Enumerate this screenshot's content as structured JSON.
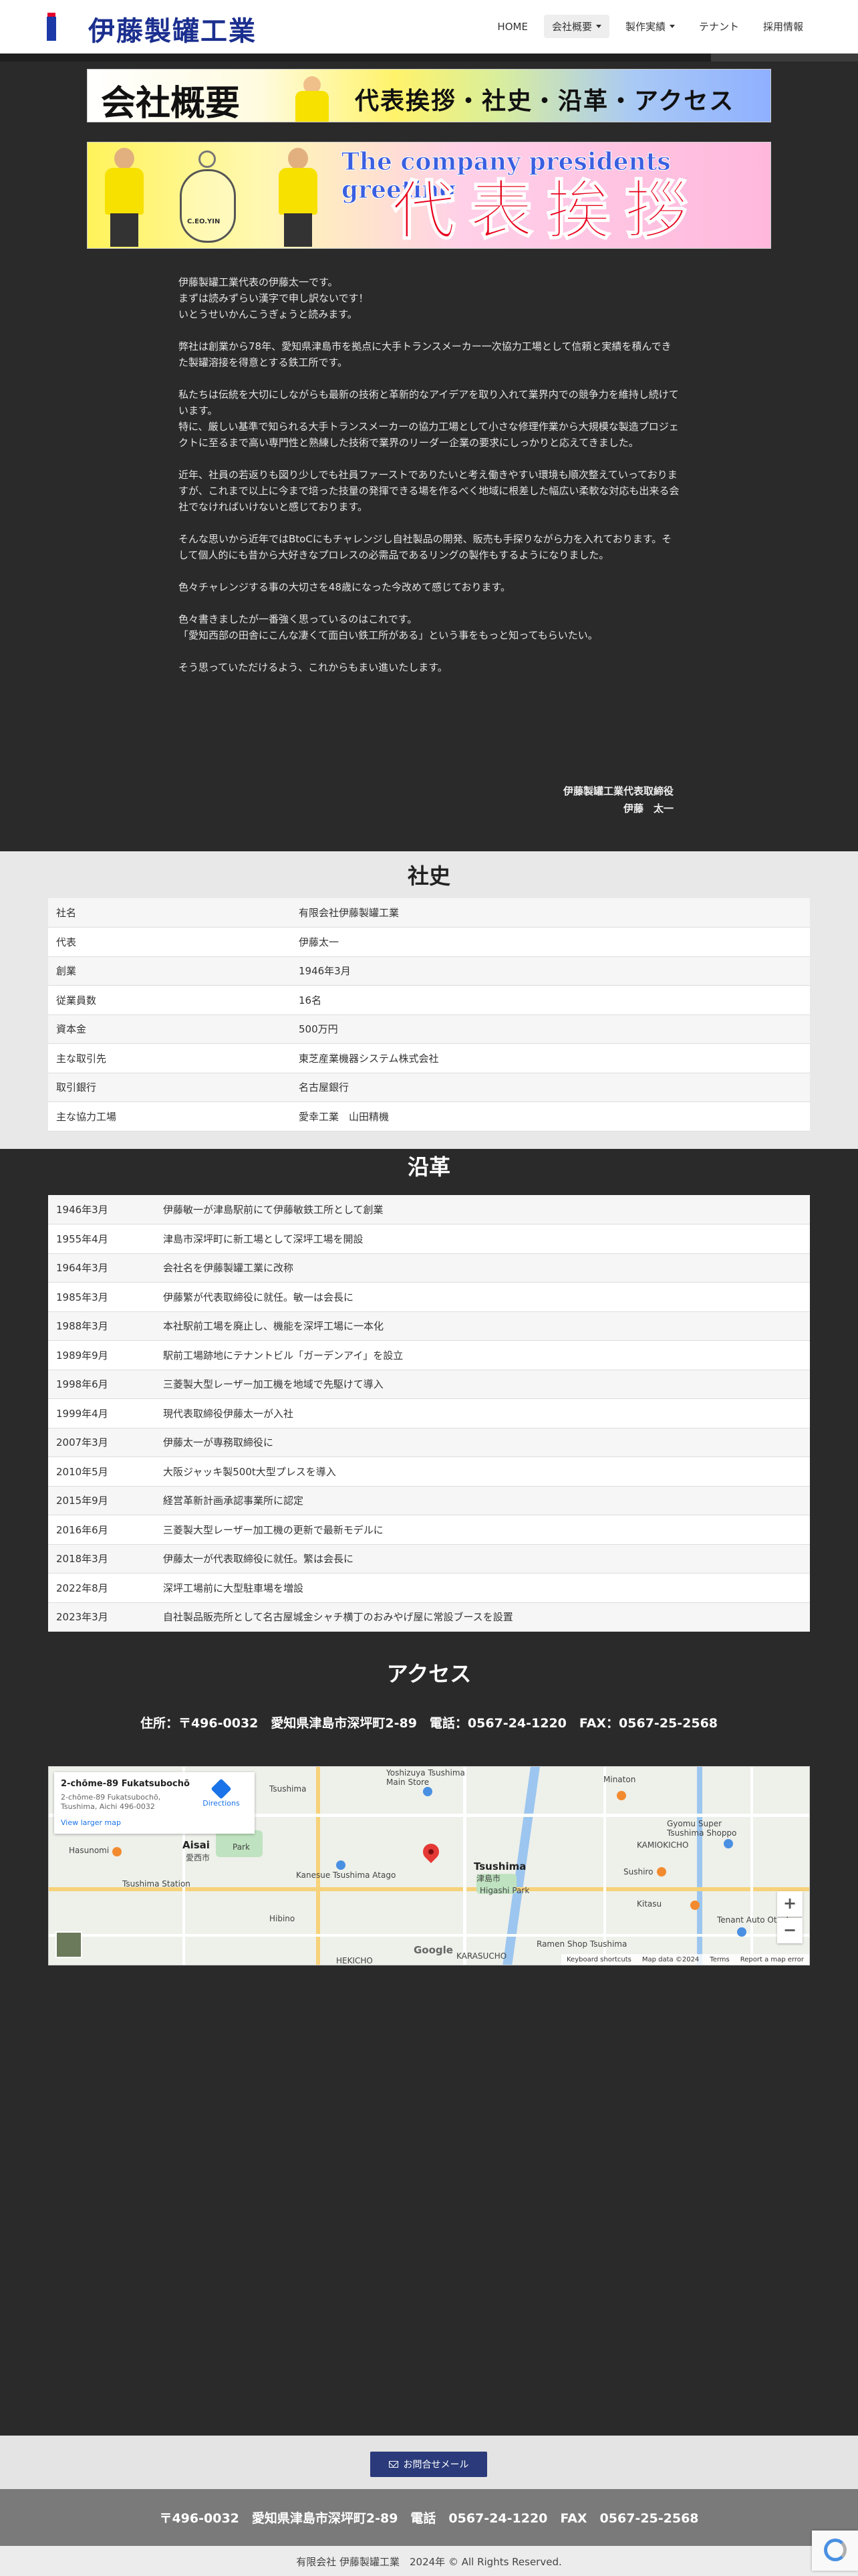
{
  "header": {
    "logo_text": "伊藤製罐工業",
    "logo_mark": "iS",
    "nav": [
      {
        "label": "HOME"
      },
      {
        "label": "会社概要"
      },
      {
        "label": "製作実績"
      },
      {
        "label": "テナント"
      },
      {
        "label": "採用情報"
      }
    ]
  },
  "banners": {
    "about_title": "会社概要",
    "about_subtitle": "代表挨拶・社史・沿革・アクセス",
    "greeting_en": "The company presidents greeting",
    "greeting_jp": "代表挨拶",
    "keychain_text": "C.EO.YIN"
  },
  "greeting": {
    "p1_l1": "伊藤製罐工業代表の伊藤太一です。",
    "p1_l2": "まずは読みずらい漢字で申し訳ないです！",
    "p1_l3": "いとうせいかんこうぎょうと読みます。",
    "p2": "弊社は創業から78年、愛知県津島市を拠点に大手トランスメーカー一次協力工場として信頼と実績を積んできた製罐溶接を得意とする鉄工所です。",
    "p3_l1": "私たちは伝統を大切にしながらも最新の技術と革新的なアイデアを取り入れて業界内での競争力を維持し続けています。",
    "p3_l2": "特に、厳しい基準で知られる大手トランスメーカーの協力工場として小さな修理作業から大規模な製造プロジェクトに至るまで高い専門性と熟練した技術で業界のリーダー企業の要求にしっかりと応えてきました。",
    "p4": "近年、社員の若返りも図り少しでも社員ファーストでありたいと考え働きやすい環境も順次整えていっておりますが、これまで以上に今まで培った技量の発揮できる場を作るべく地域に根差した幅広い柔軟な対応も出来る会社でなければいけないと感じております。",
    "p5": "そんな思いから近年ではBtoCにもチャレンジし自社製品の開発、販売も手探りながら力を入れております。そして個人的にも昔から大好きなプロレスの必需品であるリングの製作もするようになりました。",
    "p6": "色々チャレンジする事の大切さを48歳になった今改めて感じております。",
    "p7_l1": "色々書きましたが一番強く思っているのはこれです。",
    "p7_l2": "「愛知西部の田舎にこんな凄くて面白い鉄工所がある」という事をもっと知ってもらいたい。",
    "p8": "そう思っていただけるよう、これからもまい進いたします。",
    "sig_title": "伊藤製罐工業代表取締役",
    "sig_name": "伊藤　太一"
  },
  "company": {
    "title": "社史",
    "rows": [
      {
        "k": "社名",
        "v": "有限会社伊藤製罐工業"
      },
      {
        "k": "代表",
        "v": "伊藤太一"
      },
      {
        "k": "創業",
        "v": "1946年3月"
      },
      {
        "k": "従業員数",
        "v": "16名"
      },
      {
        "k": "資本金",
        "v": "500万円"
      },
      {
        "k": "主な取引先",
        "v": "東芝産業機器システム株式会社"
      },
      {
        "k": "取引銀行",
        "v": "名古屋銀行"
      },
      {
        "k": "主な協力工場",
        "v": "愛幸工業　山田精機"
      }
    ]
  },
  "history": {
    "title": "沿革",
    "rows": [
      {
        "k": "1946年3月",
        "v": "伊藤敏一が津島駅前にて伊藤敏鉄工所として創業"
      },
      {
        "k": "1955年4月",
        "v": "津島市深坪町に新工場として深坪工場を開設"
      },
      {
        "k": "1964年3月",
        "v": "会社名を伊藤製罐工業に改称"
      },
      {
        "k": "1985年3月",
        "v": "伊藤繁が代表取締役に就任。敏一は会長に"
      },
      {
        "k": "1988年3月",
        "v": "本社駅前工場を廃止し、機能を深坪工場に一本化"
      },
      {
        "k": "1989年9月",
        "v": "駅前工場跡地にテナントビル「ガーデンアイ」を設立"
      },
      {
        "k": "1998年6月",
        "v": "三菱製大型レーザー加工機を地域で先駆けて導入"
      },
      {
        "k": "1999年4月",
        "v": "現代表取締役伊藤太一が入社"
      },
      {
        "k": "2007年3月",
        "v": "伊藤太一が専務取締役に"
      },
      {
        "k": "2010年5月",
        "v": "大阪ジャッキ製500t大型プレスを導入"
      },
      {
        "k": "2015年9月",
        "v": "経営革新計画承認事業所に認定"
      },
      {
        "k": "2016年6月",
        "v": "三菱製大型レーザー加工機の更新で最新モデルに"
      },
      {
        "k": "2018年3月",
        "v": "伊藤太一が代表取締役に就任。繁は会長に"
      },
      {
        "k": "2022年8月",
        "v": "深坪工場前に大型駐車場を増設"
      },
      {
        "k": "2023年3月",
        "v": "自社製品販売所として名古屋城金シャチ横丁のおみやげ屋に常設ブースを設置"
      }
    ]
  },
  "access": {
    "title": "アクセス",
    "address": "住所：〒496-0032　愛知県津島市深坪町2-89　電話：0567-24-1220　FAX：0567-25-2568"
  },
  "map": {
    "info_title": "2-chōme-89 Fukatsubochō",
    "info_addr": "2-chōme-89 Fukatsubochō, Tsushima, Aichi 496-0032",
    "view_larger": "View larger map",
    "directions": "Directions",
    "labels": {
      "aisai": "Aisai",
      "aisai_jp": "愛西市",
      "tsushima": "Tsushima",
      "tsushima_jp": "津島市",
      "hasunomi": "Hasunomi",
      "yoshizuya": "Yoshizuya Tsushima Main Store",
      "kanesue": "Kanesue Tsushima Atago",
      "higashi_park": "Higashi Park",
      "hibino": "Hibino",
      "kamiokicho": "KAMIOKICHO",
      "minaton": "Minaton",
      "gyomu": "Gyomu Super Tsushima Shoppo",
      "sushiro": "Sushiro",
      "kitasu": "Kitasu",
      "tenant_auto": "Tenant Auto Otsubo",
      "ramen_shop": "Ramen Shop Tsushima",
      "hekicho": "HEKICHO",
      "karasucho": "KARASUCHO",
      "tsushima_station": "Tsushima Station",
      "park": "Park"
    },
    "zoom_in": "+",
    "zoom_out": "−",
    "google": "Google",
    "attribution": [
      "Keyboard shortcuts",
      "Map data ©2024",
      "Terms",
      "Report a map error"
    ]
  },
  "footer": {
    "contact_label": "お問合せメール",
    "address": "〒496-0032　愛知県津島市深坪町2-89　電話　0567-24-1220　FAX　0567-25-2568",
    "copyright": "有限会社 伊藤製罐工業　2024年 © All Rights Reserved."
  }
}
